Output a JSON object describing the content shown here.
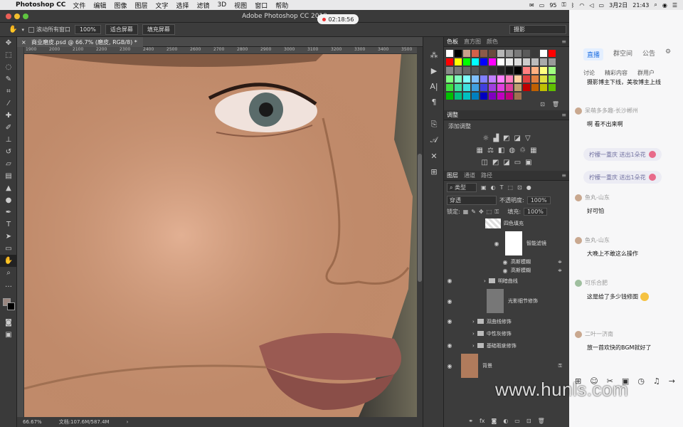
{
  "menubar": {
    "app_name": "Photoshop CC",
    "items": [
      "文件",
      "编辑",
      "图像",
      "图层",
      "文字",
      "选择",
      "滤镜",
      "3D",
      "视图",
      "窗口",
      "帮助"
    ],
    "battery_percent": "95",
    "date": "3月2日",
    "time": "21:43"
  },
  "window": {
    "title": "Adobe Photoshop CC 2018",
    "recording_time": "02:18:56"
  },
  "options": {
    "scroll_all_label": "滚动所有窗口",
    "zoom_value": "100%",
    "fit_screen": "适合屏幕",
    "fill_screen": "填充屏幕",
    "workspace": "摄影"
  },
  "document": {
    "tab_title": "商业磨皮.psd @ 66.7% (磨皮, RGB/8) *",
    "ruler_ticks": [
      "1900",
      "2000",
      "2100",
      "2200",
      "2300",
      "2400",
      "2500",
      "2600",
      "2700",
      "2800",
      "2900",
      "3000",
      "3100",
      "3200",
      "3300",
      "3400",
      "3500"
    ],
    "zoom": "66.67%",
    "doc_info": "文档:107.6M/587.4M"
  },
  "swatches_panel": {
    "tabs": [
      "色板",
      "直方图",
      "颜色"
    ]
  },
  "swatch_colors": [
    "#ffffff",
    "#000000",
    "#c9a08c",
    "#d4604a",
    "#8c5a4a",
    "#6a4a3e",
    "#b7b7b7",
    "#9a9a9a",
    "#7a7a7a",
    "#5a5a5a",
    "#3a3a3a",
    "#ffffff",
    "#ff0000",
    "#ff0000",
    "#ffff00",
    "#00ff00",
    "#00ffff",
    "#0000ff",
    "#ff00ff",
    "#ffffff",
    "#eeeeee",
    "#dddddd",
    "#cccccc",
    "#bbbbbb",
    "#aaaaaa",
    "#999999",
    "#888888",
    "#777777",
    "#666666",
    "#555555",
    "#444444",
    "#333333",
    "#222222",
    "#111111",
    "#000000",
    "#ff8080",
    "#ffb080",
    "#ffff80",
    "#a0ff80",
    "#80ff80",
    "#80ffc0",
    "#80ffff",
    "#80c0ff",
    "#8080ff",
    "#c080ff",
    "#ff80ff",
    "#ff80c0",
    "#ffd0a0",
    "#e04040",
    "#e08040",
    "#e0e040",
    "#80e040",
    "#40e040",
    "#40e0a0",
    "#40e0e0",
    "#40a0e0",
    "#4040e0",
    "#a040e0",
    "#e040e0",
    "#e040a0",
    "#c0a070",
    "#c00000",
    "#c06000",
    "#c0c000",
    "#60c000",
    "#00c000",
    "#00c080",
    "#00c0c0",
    "#0080c0",
    "#0000c0",
    "#8000c0",
    "#c000c0",
    "#c00080",
    "#a07050"
  ],
  "adjust_panel": {
    "title": "调整",
    "add_label": "添加调整"
  },
  "layers_panel": {
    "tabs": [
      "图层",
      "通道",
      "路径"
    ],
    "filter_kind": "类型",
    "blend_mode": "穿透",
    "opacity_label": "不透明度:",
    "opacity": "100%",
    "lock_label": "锁定:",
    "fill_label": "填充:",
    "fill": "100%",
    "layers": [
      {
        "name": "四色填充"
      },
      {
        "name": "智能滤镜"
      },
      {
        "name": "高斯模糊"
      },
      {
        "name": "高斯模糊"
      },
      {
        "name": "明暗曲线"
      },
      {
        "name": "光影细节修饰"
      },
      {
        "name": "双曲线修饰"
      },
      {
        "name": "中性灰修饰"
      },
      {
        "name": "基础瑕疵修饰"
      },
      {
        "name": "背景"
      }
    ]
  },
  "chat": {
    "tabs": [
      "直播",
      "群空间",
      "公告"
    ],
    "subtabs": [
      "讨论",
      "精彩内容",
      "群用户"
    ],
    "top_text": "摄影博主下线，美妆博主上线",
    "gift1": "柠檬一重庆 送出1朵花",
    "gift2": "柠檬一重庆 送出1朵花",
    "messages": [
      {
        "name": "呆萌多多趣-长沙郴州",
        "text": "啊 看不出来啊"
      },
      {
        "name": "鱼丸-山东",
        "text": "好可怕"
      },
      {
        "name": "鱼丸-山东",
        "text": "大晚上不敢这么操作"
      },
      {
        "name": "可乐合肥",
        "text": "这是给了多少钱修图"
      },
      {
        "name": "二叶一济南",
        "text": "放一首欢快的BGM就好了"
      }
    ]
  },
  "watermark": "www.hunls.com"
}
